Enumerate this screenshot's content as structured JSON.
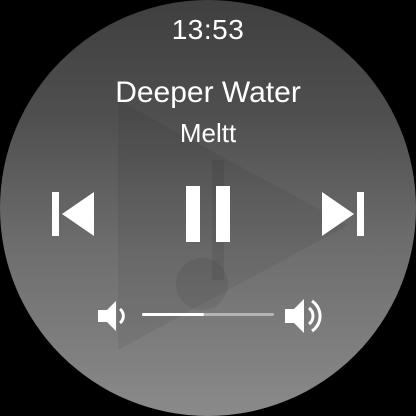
{
  "status": {
    "time": "13:53"
  },
  "now_playing": {
    "title": "Deeper Water",
    "artist": "Meltt"
  },
  "controls": {
    "previous_icon": "skip-previous-icon",
    "play_pause_icon": "pause-icon",
    "next_icon": "skip-next-icon"
  },
  "volume": {
    "level": 0.47,
    "down_icon": "volume-down-icon",
    "up_icon": "volume-up-icon"
  },
  "background_art": {
    "icon": "play-music-icon"
  },
  "colors": {
    "foreground": "#ffffff",
    "slider_track": "#b4b4b4",
    "background_top": "#3f3f3f",
    "background_bottom": "#8a8a8a"
  }
}
